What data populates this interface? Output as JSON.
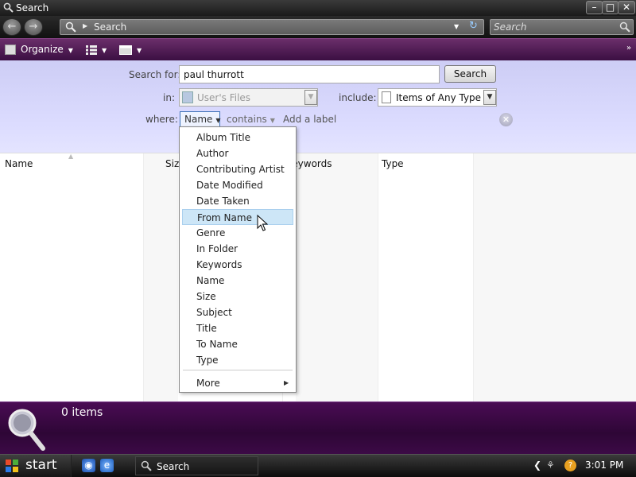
{
  "window": {
    "title": "Search",
    "minimize": "–",
    "maximize": "□",
    "close": "✕"
  },
  "nav": {
    "back": "←",
    "forward": "→",
    "address_icon": "search-icon",
    "address_text": "Search",
    "search_placeholder": "Search"
  },
  "toolbar": {
    "organize_label": "Organize",
    "views_icon": "views-icon",
    "layout_icon": "layout-icon",
    "overflow": "»"
  },
  "search_pane": {
    "search_for_label": "Search for:",
    "query_value": "paul thurrott",
    "search_button": "Search",
    "in_label": "in:",
    "in_value": "User's Files",
    "include_label": "include:",
    "include_value": "Items of Any Type",
    "where_label": "where:",
    "where_value": "Name",
    "contains_value": "contains",
    "add_label_text": "Add a label",
    "clear_icon": "close-icon"
  },
  "columns": {
    "name": "Name",
    "size": "Size",
    "keywords": "Keywords",
    "type": "Type"
  },
  "property_menu": {
    "items": [
      "Album Title",
      "Author",
      "Contributing Artist",
      "Date Modified",
      "Date Taken",
      "From Name",
      "Genre",
      "In Folder",
      "Keywords",
      "Name",
      "Size",
      "Subject",
      "Title",
      "To Name",
      "Type"
    ],
    "highlighted": "From Name",
    "more_label": "More"
  },
  "details": {
    "item_count": "0 items"
  },
  "taskbar": {
    "start_label": "start",
    "task_label": "Search",
    "clock": "3:01 PM"
  },
  "colors": {
    "toolbar": "#4a1552",
    "search_pane": "#d8d8fc",
    "details_pane": "#3a0a44",
    "menu_highlight": "#cde6f7"
  }
}
